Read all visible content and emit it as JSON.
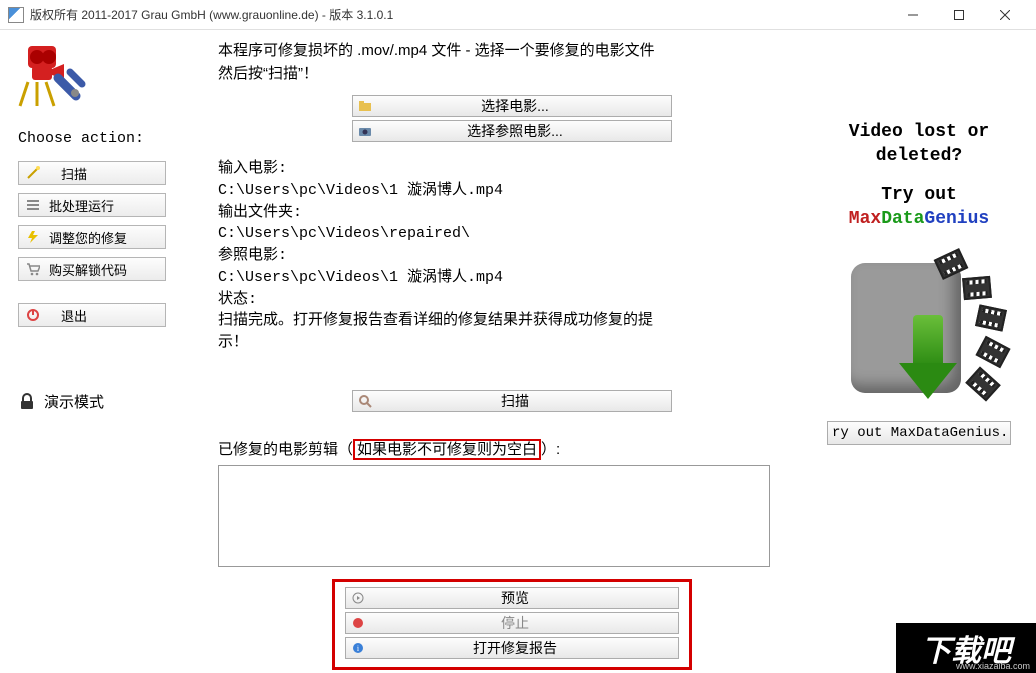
{
  "window": {
    "title": "版权所有 2011-2017 Grau GmbH (www.grauonline.de) - 版本 3.1.0.1"
  },
  "sidebar": {
    "heading": "Choose action:",
    "buttons": {
      "scan": "扫描",
      "batch": "批处理运行",
      "adjust": "调整您的修复",
      "unlock": "购买解锁代码",
      "exit": "退出"
    },
    "demo": "演示模式"
  },
  "main": {
    "intro_line1": "本程序可修复损坏的 .mov/.mp4 文件 - 选择一个要修复的电影文件",
    "intro_line2": "然后按“扫描”！",
    "select_movie": "选择电影...",
    "select_ref": "选择参照电影...",
    "input_label": "输入电影:",
    "input_path": "C:\\Users\\pc\\Videos\\1 漩涡博人.mp4",
    "output_label": "输出文件夹:",
    "output_path": "C:\\Users\\pc\\Videos\\repaired\\",
    "ref_label": "参照电影:",
    "ref_path": "C:\\Users\\pc\\Videos\\1 漩涡博人.mp4",
    "status_label": "状态:",
    "status_text1": "扫描完成。打开修复报告查看详细的修复结果并获得成功修复的提",
    "status_text2": "示！",
    "scan_button": "扫描",
    "clip_prefix": "已修复的电影剪辑（",
    "clip_red": "如果电影不可修复则为空白",
    "clip_suffix": "）:",
    "preview": "预览",
    "stop": "停止",
    "report": "打开修复报告"
  },
  "ad": {
    "line1": "Video lost or",
    "line2": "deleted?",
    "line3": "Try out",
    "max": "Max",
    "data": "Data",
    "genius": "Genius",
    "button": "ry out MaxDataGenius.."
  },
  "footer": {
    "brand": "下载吧",
    "url": "www.xiazaiba.com"
  }
}
